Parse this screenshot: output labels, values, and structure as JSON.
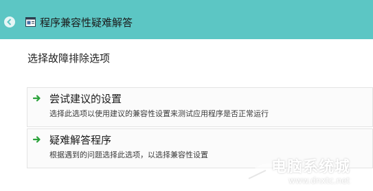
{
  "window": {
    "title": "程序兼容性疑难解答",
    "colors": {
      "titlebar": "#5cc6c4",
      "arrow": "#2aa23a"
    }
  },
  "main": {
    "heading": "选择故障排除选项",
    "options": [
      {
        "title": "尝试建议的设置",
        "description": "选择此选项以使用建议的兼容性设置来测试应用程序是否正常运行",
        "icon": "green-arrow-icon"
      },
      {
        "title": "疑难解答程序",
        "description": "根据遇到的问题选择此选项，以选择兼容性设置",
        "icon": "green-arrow-icon"
      }
    ]
  },
  "watermark": {
    "text": "电脑系统城",
    "url": "www.dnxtc.net"
  }
}
